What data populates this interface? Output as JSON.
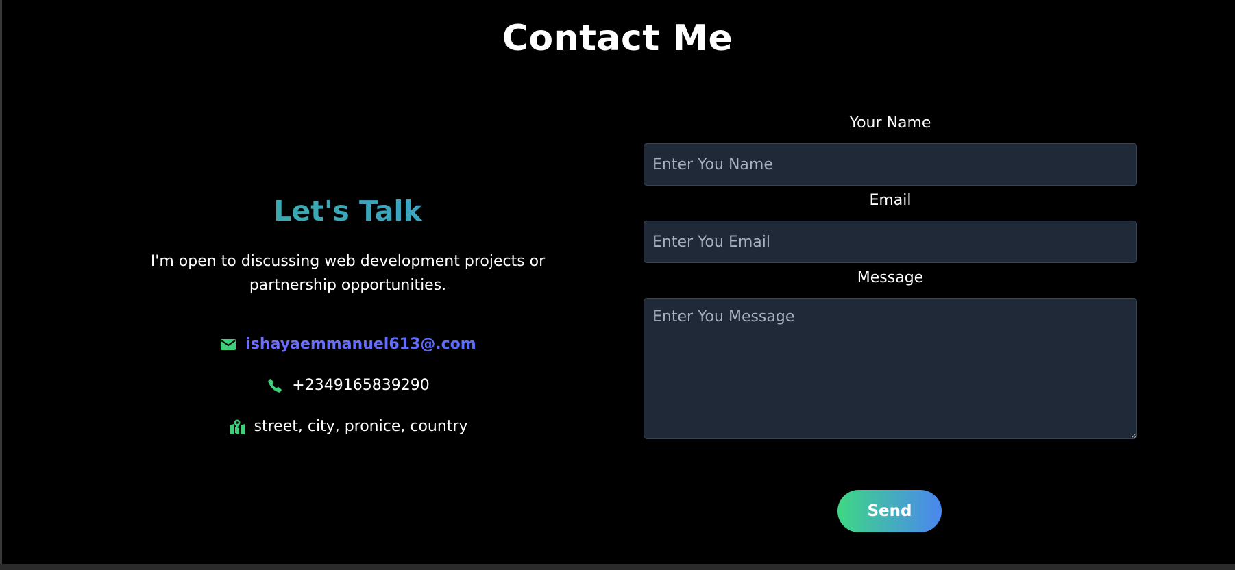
{
  "page": {
    "title": "Contact Me"
  },
  "left": {
    "heading": "Let's Talk",
    "intro": "I'm open to discussing web development projects or partnership opportunities.",
    "contacts": [
      {
        "icon": "envelope-icon",
        "text": "ishayaemmanuel613@.com"
      },
      {
        "icon": "phone-icon",
        "text": "+2349165839290"
      },
      {
        "icon": "map-location-icon",
        "text": "street, city, pronice, country"
      }
    ]
  },
  "form": {
    "name": {
      "label": "Your Name",
      "placeholder": "Enter You Name",
      "value": ""
    },
    "email": {
      "label": "Email",
      "placeholder": "Enter You Email",
      "value": ""
    },
    "message": {
      "label": "Message",
      "placeholder": "Enter You Message",
      "value": ""
    },
    "send_label": "Send"
  },
  "colors": {
    "background": "#000000",
    "accent_green": "#3ed884",
    "accent_blue": "#4a86f0",
    "link": "#6363ff",
    "input_bg": "#1f2937",
    "icon_green": "#3fcf7a"
  }
}
